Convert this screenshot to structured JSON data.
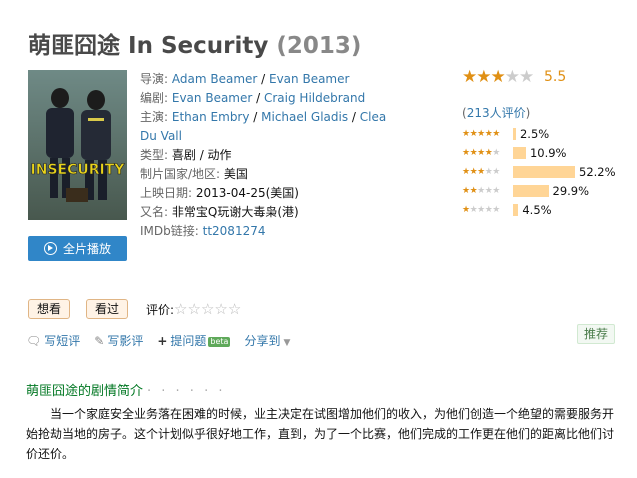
{
  "title": {
    "cn": "萌匪囧途",
    "en": "In Security",
    "year": "(2013)"
  },
  "poster": {
    "alt": "In Security poster",
    "logo_text": "INSECURITY"
  },
  "info": {
    "director_label": "导演:",
    "directors": [
      "Adam Beamer",
      "Evan Beamer"
    ],
    "writer_label": "编剧:",
    "writers": [
      "Evan Beamer",
      "Craig Hildebrand"
    ],
    "cast_label": "主演:",
    "cast": [
      "Ethan Embry",
      "Michael Gladis",
      "Clea Du Vall"
    ],
    "genre_label": "类型:",
    "genre": "喜剧 / 动作",
    "country_label": "制片国家/地区:",
    "country": "美国",
    "release_label": "上映日期:",
    "release": "2013-04-25(美国)",
    "aka_label": "又名:",
    "aka": "非常宝Q玩谢大毒枭(港)",
    "imdb_label": "IMDb链接:",
    "imdb": "tt2081274",
    "separator": " / "
  },
  "play_button": {
    "label": "全片播放",
    "icon": "play-circle-icon"
  },
  "rating": {
    "score": "5.5",
    "stars_filled": 3,
    "stars_total": 5,
    "votes_open": "(",
    "votes_count": "213",
    "votes_suffix": "人评价",
    "votes_close": ")",
    "distribution": [
      {
        "stars": 5,
        "percent": 2.5,
        "label": "2.5%"
      },
      {
        "stars": 4,
        "percent": 10.9,
        "label": "10.9%"
      },
      {
        "stars": 3,
        "percent": 52.2,
        "label": "52.2%"
      },
      {
        "stars": 2,
        "percent": 29.9,
        "label": "29.9%"
      },
      {
        "stars": 1,
        "percent": 4.5,
        "label": "4.5%"
      }
    ],
    "star_color": "#e09015",
    "bar_color": "#ffd596"
  },
  "user_actions": {
    "want": "想看",
    "seen": "看过",
    "rate_label": "评价:",
    "write_short": "写短评",
    "write_review": "写影评",
    "ask": "提问题",
    "beta": "beta",
    "share": "分享到",
    "recommend": "推荐"
  },
  "summary": {
    "heading": "萌匪囧途的剧情简介",
    "dots": "· · · · · ·",
    "text": "当一个家庭安全业务落在困难的时候，业主决定在试图增加他们的收入，为他们创造一个绝望的需要服务开始抢劫当地的房子。这个计划似乎很好地工作，直到，为了一个比赛，他们完成的工作更在他们的距离比他们讨价还价。"
  }
}
